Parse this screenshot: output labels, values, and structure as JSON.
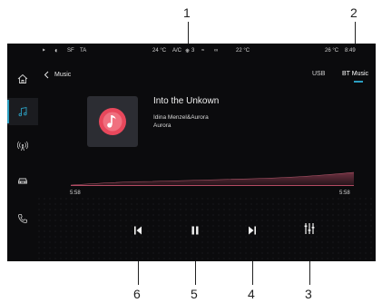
{
  "callouts": [
    "1",
    "2",
    "3",
    "4",
    "5",
    "6"
  ],
  "status_bar": {
    "left_items": [
      "SF",
      "TA"
    ],
    "center_temp": "24 °C",
    "ac_label": "A/C",
    "fan_level": "3",
    "right_temp": "22 °C",
    "outside_temp": "26 °C",
    "clock": "8:49"
  },
  "sidebar": {
    "items": [
      {
        "icon": "home-icon",
        "active": false
      },
      {
        "icon": "music-note-icon",
        "active": true
      },
      {
        "icon": "radio-icon",
        "active": false
      },
      {
        "icon": "car-icon",
        "active": false
      },
      {
        "icon": "phone-icon",
        "active": false
      }
    ]
  },
  "topbar": {
    "back_label": "Music",
    "tabs": [
      {
        "label": "USB",
        "active": false
      },
      {
        "label": "BT Music",
        "active": true
      }
    ]
  },
  "now_playing": {
    "title": "Into the Unkown",
    "artist": "Idina Menzel&Aurora",
    "album": "Aurora",
    "elapsed": "5:58",
    "duration": "5:58",
    "progress_fraction": 1.0
  },
  "controls": [
    {
      "icon": "previous-icon"
    },
    {
      "icon": "play-pause-icon"
    },
    {
      "icon": "next-icon"
    },
    {
      "icon": "equalizer-icon"
    }
  ],
  "colors": {
    "accent": "#2b9ec0",
    "wave": "#c0506a",
    "album_icon": "#e8485c",
    "background": "#0b0b0d"
  }
}
